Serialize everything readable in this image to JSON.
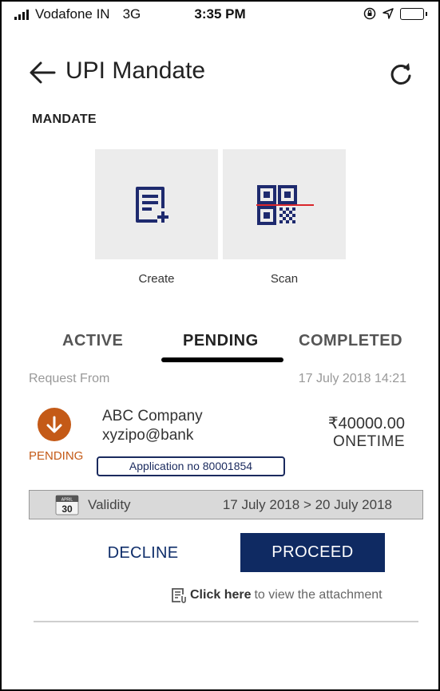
{
  "status_bar": {
    "carrier": "Vodafone IN",
    "network": "3G",
    "time": "3:35 PM"
  },
  "header": {
    "title": "UPI Mandate"
  },
  "section": {
    "title": "MANDATE"
  },
  "actions": [
    {
      "label": "Create",
      "icon": "create-document-icon"
    },
    {
      "label": "Scan",
      "icon": "qr-code-icon"
    }
  ],
  "tabs": [
    {
      "label": "ACTIVE",
      "selected": false
    },
    {
      "label": "PENDING",
      "selected": true
    },
    {
      "label": "COMPLETED",
      "selected": false
    }
  ],
  "request": {
    "from_label": "Request From",
    "datetime": "17 July 2018 14:21",
    "status": "PENDING",
    "status_color": "#c45a17",
    "payee_name": "ABC Company",
    "payee_vpa": "xyzipo@bank",
    "amount": "₹40000.00",
    "frequency": "ONETIME",
    "application": "Application no 80001854",
    "validity_label": "Validity",
    "validity_range": "17 July 2018 > 20 July 2018",
    "calendar_day": "30",
    "calendar_month": "APRIL"
  },
  "buttons": {
    "decline": "DECLINE",
    "proceed": "PROCEED",
    "proceed_color": "#0f2a62"
  },
  "attachment": {
    "link_text": "Click here",
    "rest_text": "to view the attachment"
  }
}
